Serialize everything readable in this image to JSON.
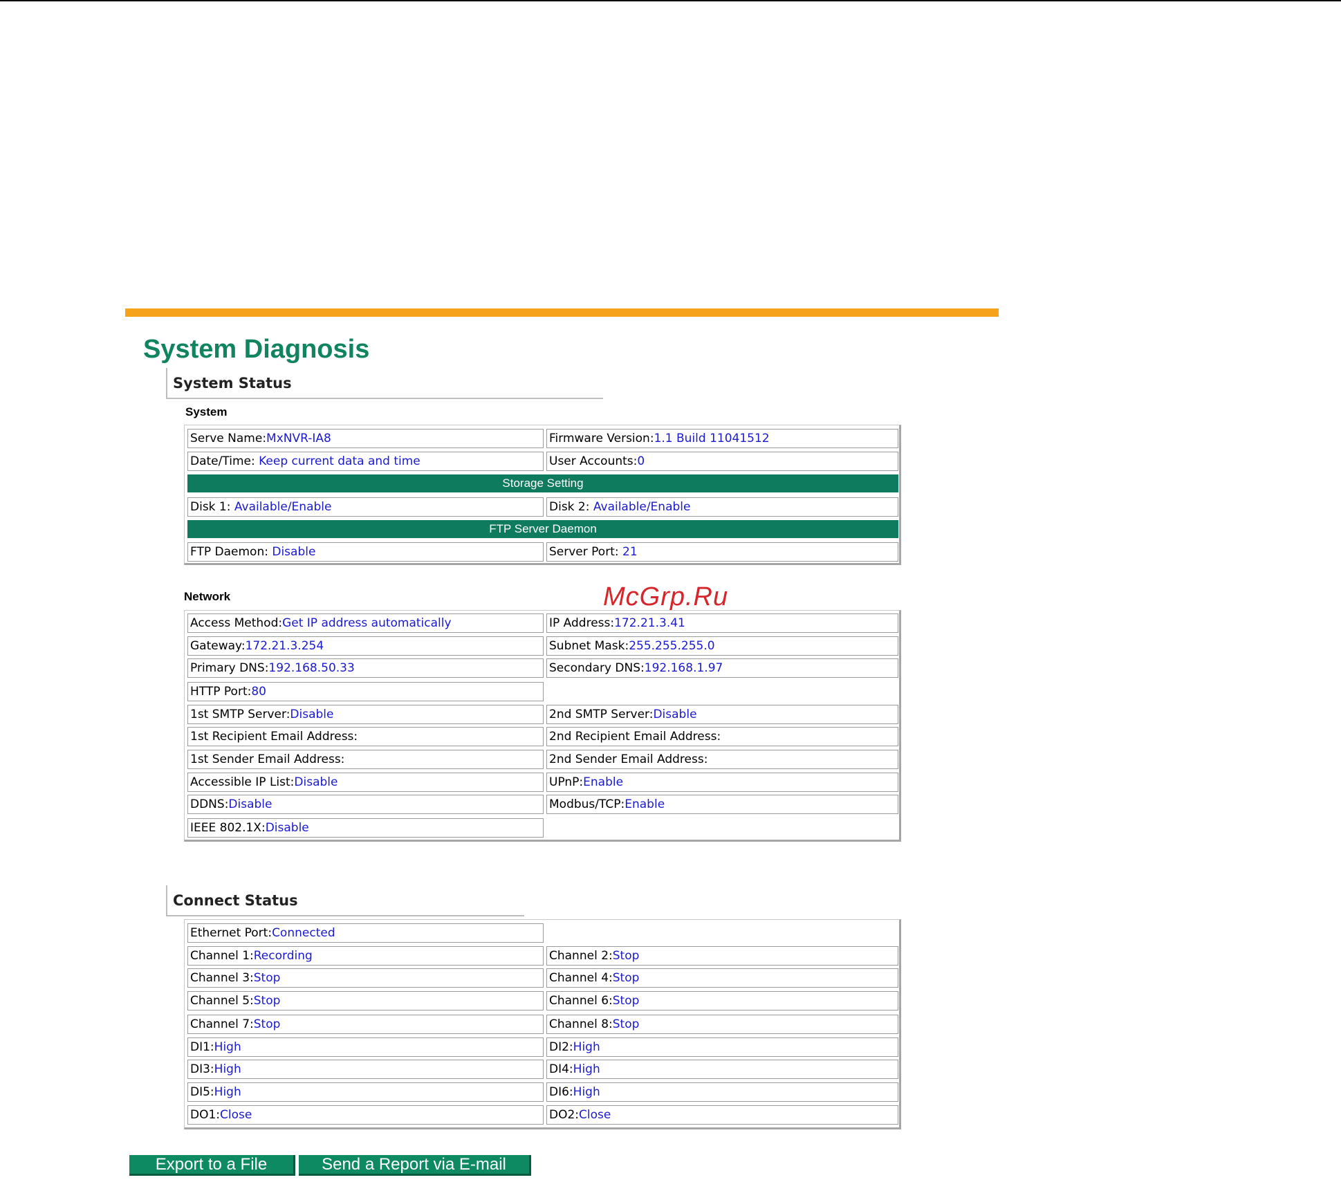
{
  "title": "System Diagnosis",
  "watermark": "McGrp.Ru",
  "system_status": {
    "header": "System Status",
    "system": {
      "label": "System",
      "server_name": {
        "label": "Serve Name:",
        "value": "MxNVR-IA8"
      },
      "firmware_version": {
        "label": "Firmware Version:",
        "value": "1.1 Build 11041512"
      },
      "date_time": {
        "label": "Date/Time:",
        "value": "Keep current data and time"
      },
      "user_accounts": {
        "label": "User Accounts:",
        "value": "0"
      },
      "storage_band": "Storage Setting",
      "disk1": {
        "label": "Disk 1:",
        "value": "Available/Enable"
      },
      "disk2": {
        "label": "Disk 2:",
        "value": "Available/Enable"
      },
      "ftp_band": "FTP Server Daemon",
      "ftp_daemon": {
        "label": "FTP Daemon:",
        "value": "Disable"
      },
      "server_port": {
        "label": "Server Port:",
        "value": "21"
      }
    },
    "network": {
      "label": "Network",
      "access_method": {
        "label": "Access Method:",
        "value": "Get IP address automatically"
      },
      "ip_address": {
        "label": "IP Address:",
        "value": "172.21.3.41"
      },
      "gateway": {
        "label": "Gateway:",
        "value": "172.21.3.254"
      },
      "subnet_mask": {
        "label": "Subnet Mask:",
        "value": "255.255.255.0"
      },
      "primary_dns": {
        "label": "Primary DNS:",
        "value": "192.168.50.33"
      },
      "secondary_dns": {
        "label": "Secondary DNS:",
        "value": "192.168.1.97"
      },
      "http_port": {
        "label": "HTTP Port:",
        "value": "80"
      },
      "smtp1": {
        "label": "1st SMTP Server:",
        "value": "Disable"
      },
      "smtp2": {
        "label": "2nd SMTP Server:",
        "value": "Disable"
      },
      "recipient1": {
        "label": "1st Recipient Email Address:",
        "value": ""
      },
      "recipient2": {
        "label": "2nd Recipient Email Address:",
        "value": ""
      },
      "sender1": {
        "label": "1st Sender Email Address:",
        "value": ""
      },
      "sender2": {
        "label": "2nd Sender Email Address:",
        "value": ""
      },
      "accessible_ip": {
        "label": "Accessible IP List:",
        "value": "Disable"
      },
      "upnp": {
        "label": "UPnP:",
        "value": "Enable"
      },
      "ddns": {
        "label": "DDNS:",
        "value": "Disable"
      },
      "modbus": {
        "label": "Modbus/TCP:",
        "value": "Enable"
      },
      "ieee": {
        "label": "IEEE 802.1X:",
        "value": "Disable"
      }
    }
  },
  "connect_status": {
    "header": "Connect Status",
    "ethernet": {
      "label": "Ethernet Port:",
      "value": "Connected"
    },
    "ch1": {
      "label": "Channel 1:",
      "value": "Recording"
    },
    "ch2": {
      "label": "Channel 2:",
      "value": "Stop"
    },
    "ch3": {
      "label": "Channel 3:",
      "value": "Stop"
    },
    "ch4": {
      "label": "Channel 4:",
      "value": "Stop"
    },
    "ch5": {
      "label": "Channel 5:",
      "value": "Stop"
    },
    "ch6": {
      "label": "Channel 6:",
      "value": "Stop"
    },
    "ch7": {
      "label": "Channel 7:",
      "value": "Stop"
    },
    "ch8": {
      "label": "Channel 8:",
      "value": "Stop"
    },
    "di1": {
      "label": "DI1:",
      "value": "High"
    },
    "di2": {
      "label": "DI2:",
      "value": "High"
    },
    "di3": {
      "label": "DI3:",
      "value": "High"
    },
    "di4": {
      "label": "DI4:",
      "value": "High"
    },
    "di5": {
      "label": "DI5:",
      "value": "High"
    },
    "di6": {
      "label": "DI6:",
      "value": "High"
    },
    "do1": {
      "label": "DO1:",
      "value": "Close"
    },
    "do2": {
      "label": "DO2:",
      "value": "Close"
    }
  },
  "buttons": {
    "export": "Export to a File",
    "email": "Send a Report via E-mail"
  },
  "colors": {
    "accent_orange": "#f7a21b",
    "title_green": "#108461",
    "band_green": "#0e7a5e",
    "value_blue": "#1a1ad0",
    "watermark_red": "#d6262b"
  }
}
